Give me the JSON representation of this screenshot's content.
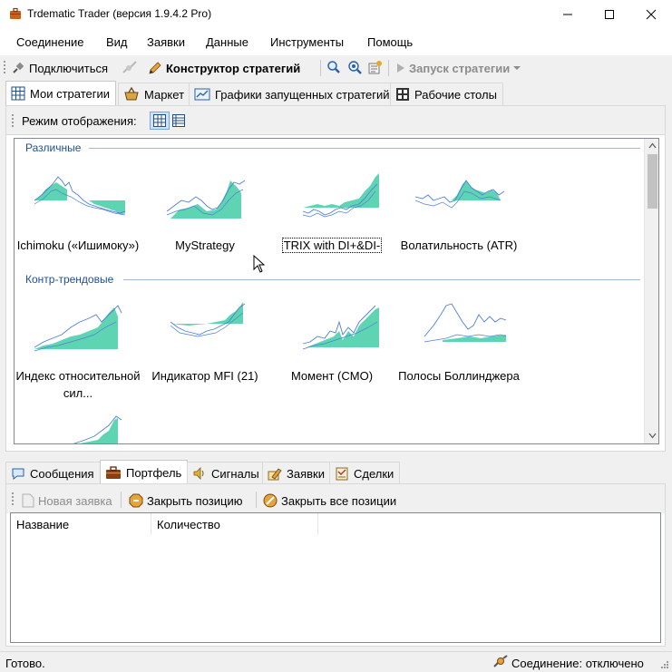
{
  "window": {
    "title": "Trdematic Trader (версия 1.9.4.2 Pro)"
  },
  "menu": [
    "Соединение",
    "Вид",
    "Заявки",
    "Данные",
    "Инструменты",
    "Помощь"
  ],
  "toolbar": {
    "connect": "Подключиться",
    "builder": "Конструктор стратегий",
    "run": "Запуск стратегии"
  },
  "tabs": [
    "Мои стратегии",
    "Маркет",
    "Графики запущенных стратегий",
    "Рабочие столы"
  ],
  "view_mode_label": "Режим отображения:",
  "groups": [
    {
      "title": "Различные",
      "items": [
        "Ichimoku («Ишимоку»)",
        "MyStrategy",
        "TRIX with DI+&DI-",
        "Волатильность (ATR)"
      ]
    },
    {
      "title": "Контр-трендовые",
      "items": [
        "Индекс относительной сил...",
        "Индикатор MFI (21)",
        "Момент (CMO)",
        "Полосы Боллинджера"
      ]
    }
  ],
  "bottom_tabs": [
    "Сообщения",
    "Портфель",
    "Сигналы",
    "Заявки",
    "Сделки"
  ],
  "bottom_toolbar": {
    "new_order": "Новая заявка",
    "close_position": "Закрыть позицию",
    "close_all": "Закрыть все позиции"
  },
  "portfolio_table": {
    "columns": [
      "Название",
      "Количество"
    ]
  },
  "status": {
    "left": "Готово.",
    "connection": "Соединение: отключено"
  },
  "colors": {
    "fill": "#5fd4b3",
    "line": "#4f7fd6",
    "group_title": "#1e4f9b"
  }
}
